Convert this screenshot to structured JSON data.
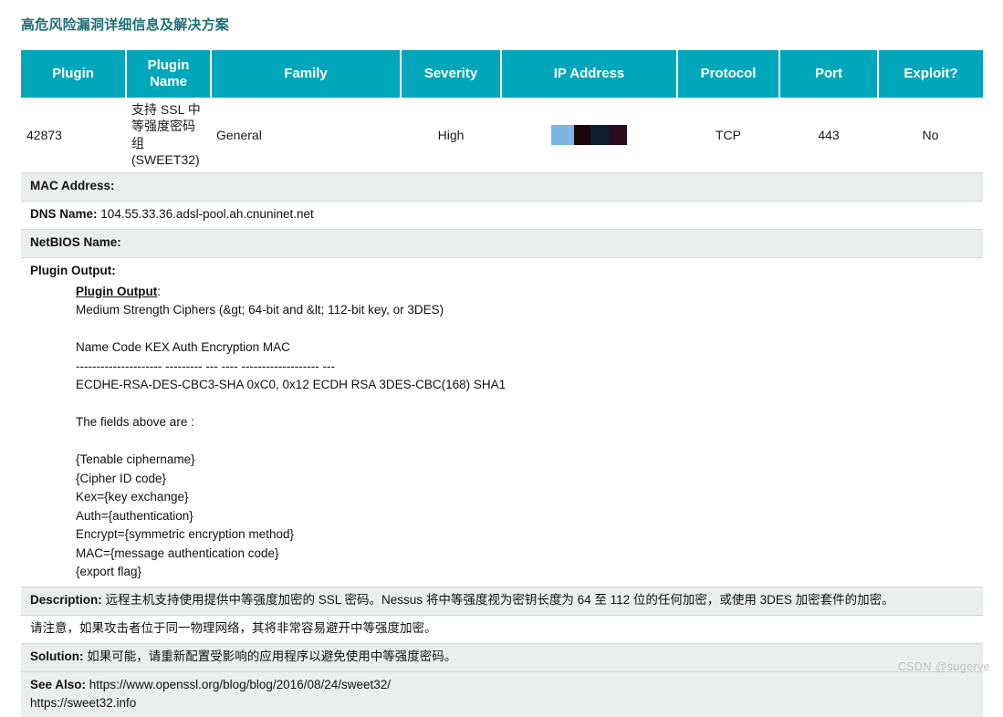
{
  "page": {
    "title": "高危风险漏洞详细信息及解决方案",
    "watermark": "CSDN @sugerve"
  },
  "colors": {
    "header_teal": "#00a7ba",
    "title_teal": "#1f6f78",
    "row_shade": "#eceded",
    "row_plain": "#ffffff",
    "border": "#d6d6d6",
    "redaction_1": "#7db4e3",
    "redaction_2": "#1a050a",
    "redaction_3": "#0d1d30",
    "redaction_4": "#2b0c1e"
  },
  "table": {
    "columns": [
      {
        "key": "plugin",
        "label": "Plugin"
      },
      {
        "key": "plugin_name",
        "label": "Plugin Name"
      },
      {
        "key": "family",
        "label": "Family"
      },
      {
        "key": "severity",
        "label": "Severity"
      },
      {
        "key": "ip_address",
        "label": "IP Address"
      },
      {
        "key": "protocol",
        "label": "Protocol"
      },
      {
        "key": "port",
        "label": "Port"
      },
      {
        "key": "exploit",
        "label": "Exploit?"
      }
    ],
    "row": {
      "plugin": "42873",
      "plugin_name": "支持 SSL 中等强度密码组 (SWEET32)",
      "family": "General",
      "severity": "High",
      "ip_address_redacted": true,
      "protocol": "TCP",
      "port": "443",
      "exploit": "No"
    }
  },
  "details": {
    "mac_address_label": "MAC Address:",
    "mac_address_value": "",
    "dns_name_label": "DNS Name:",
    "dns_name_value": "104.55.33.36.adsl-pool.ah.cnuninet.net",
    "netbios_label": "NetBIOS Name:",
    "netbios_value": "",
    "plugin_output_label": "Plugin Output:",
    "plugin_output_inner_label": "Plugin Output",
    "plugin_output_inner_colon": ":",
    "plugin_output_body": "Medium Strength Ciphers (&gt; 64-bit and &lt; 112-bit key, or 3DES)\n\nName Code KEX Auth Encryption MAC\n--------------------- --------- --- ---- ------------------- ---\nECDHE-RSA-DES-CBC3-SHA 0xC0, 0x12 ECDH RSA 3DES-CBC(168) SHA1\n\nThe fields above are :\n\n{Tenable ciphername}\n{Cipher ID code}\nKex={key exchange}\nAuth={authentication}\nEncrypt={symmetric encryption method}\nMAC={message authentication code}\n{export flag}",
    "description_label": "Description:",
    "description_value": "远程主机支持使用提供中等强度加密的 SSL 密码。Nessus 将中等强度视为密钥长度为 64 至 112 位的任何加密，或使用 3DES 加密套件的加密。",
    "description_note": "请注意，如果攻击者位于同一物理网络，其将非常容易避开中等强度加密。",
    "solution_label": "Solution:",
    "solution_value": "如果可能，请重新配置受影响的应用程序以避免使用中等强度密码。",
    "see_also_label": "See Also:",
    "see_also_links": [
      "https://www.openssl.org/blog/blog/2016/08/24/sweet32/",
      "https://sweet32.info"
    ]
  }
}
